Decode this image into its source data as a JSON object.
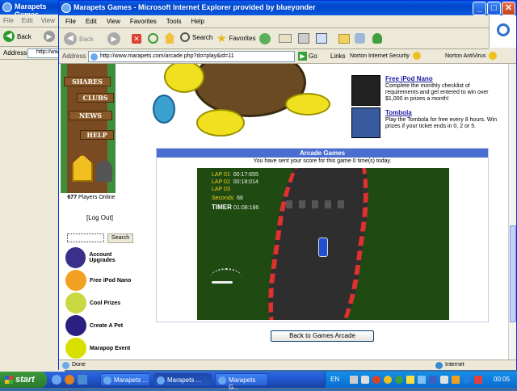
{
  "back_window": {
    "title": "Marapets Games",
    "menu": [
      "File",
      "Edit",
      "View"
    ],
    "back_label": "Back",
    "address_label": "Address",
    "address_value": "http://ww"
  },
  "window": {
    "title": "Marapets Games - Microsoft Internet Explorer provided by blueyonder",
    "menu": [
      "File",
      "Edit",
      "View",
      "Favorites",
      "Tools",
      "Help"
    ],
    "toolbar": {
      "back": "Back",
      "search": "Search",
      "favorites": "Favorites"
    },
    "address_label": "Address",
    "address_value": "http://www.marapets.com/arcade.php?do=play&id=11",
    "go_label": "Go",
    "links_label": "Links",
    "norton_label": "Norton Internet Security",
    "antivirus_label": "Norton AntiVirus"
  },
  "sidebar": {
    "signs": [
      "SHARES",
      "CLUBS",
      "NEWS",
      "HELP"
    ],
    "players_count": "677",
    "players_label": "Players Online",
    "logout": "[Log Out]",
    "search_button": "Search",
    "items": [
      {
        "label": "Account Upgrades",
        "color": "#3a2f8a"
      },
      {
        "label": "Free iPod Nano",
        "color": "#f2a020"
      },
      {
        "label": "Cool Prizes",
        "color": "#c8d840"
      },
      {
        "label": "Create A Pet",
        "color": "#2a2080"
      },
      {
        "label": "Marapop Event",
        "color": "#d8e000"
      }
    ]
  },
  "ads": [
    {
      "title": "Free iPod Nano",
      "text": "Complete the monthly checklist of requirements and get entered to win over $1,000 in prizes a month!"
    },
    {
      "title": "Tombola",
      "text": "Play the Tombola for free every 8 hours. Win prizes if your ticket ends in 0, 2 or 5."
    }
  ],
  "arcade": {
    "header": "Arcade Games",
    "score_msg": "You have sent your score for this game 0 time(s) today.",
    "laps": [
      {
        "label": "LAP 01",
        "time": "00:17:655"
      },
      {
        "label": "LAP 02",
        "time": "00:18:014"
      },
      {
        "label": "LAP 03",
        "time": ""
      }
    ],
    "seconds_label": "Seconds",
    "seconds_value": "68",
    "timer_label": "TIMER",
    "timer_value": "01:08:186",
    "back_button": "Back to Games Arcade"
  },
  "status": {
    "done": "Done",
    "zone": "Internet"
  },
  "taskbar": {
    "start": "start",
    "tasks": [
      "Marapets ...",
      "Marapets ...",
      "Marapets G..."
    ],
    "lang": "EN",
    "clock": "00:05"
  },
  "colors": {
    "accent": "#4a6ed0",
    "track": "#2e2e2e",
    "grass": "#1f4a12"
  }
}
